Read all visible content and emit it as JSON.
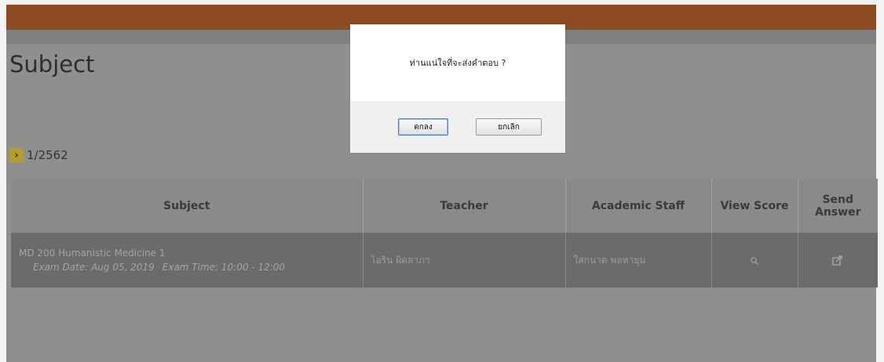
{
  "colors": {
    "header_bar": "#8b4a1f",
    "overlay_gray": "#8f8f8f",
    "term_chevron": "#b59d2c",
    "row_background": "#6b6b6b"
  },
  "page": {
    "title": "Subject",
    "term": {
      "chevron_icon": "chevron-right-icon",
      "label": "1/2562"
    }
  },
  "table": {
    "headers": [
      "Subject",
      "Teacher",
      "Academic Staff",
      "View Score",
      "Send Answer"
    ],
    "rows": [
      {
        "subject": "MD 200 Humanistic Medicine 1",
        "exam_date": "Exam Date: Aug 05, 2019",
        "exam_time": "Exam Time: 10:00 - 12:00",
        "teacher": "ไอริน ผิดลาภา",
        "academic_staff": "ใสกนาด พลหายุม",
        "view_score_icon": "search-icon",
        "send_answer_icon": "send-answer-icon"
      }
    ]
  },
  "dialog": {
    "message": "ท่านแน่ใจที่จะส่งคำตอบ ?",
    "ok_label": "ตกลง",
    "cancel_label": "ยกเลิก"
  }
}
